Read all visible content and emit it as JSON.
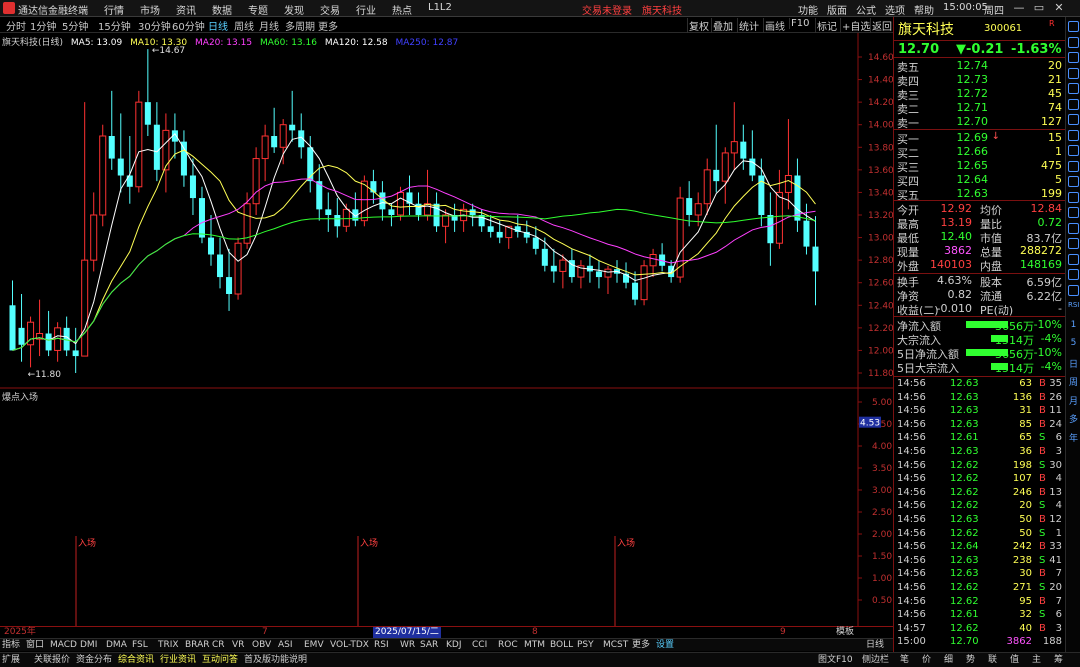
{
  "app": {
    "title": "通达信金融终端"
  },
  "menu": [
    "行情",
    "市场",
    "资讯",
    "数据",
    "专题",
    "发现",
    "交易",
    "行业",
    "热点",
    "L1L2"
  ],
  "red_menu": [
    "交易未登录",
    "旗天科技"
  ],
  "func_menu": [
    "功能",
    "版面",
    "公式",
    "选项",
    "帮助"
  ],
  "clock": {
    "time": "15:00:05",
    "weekday": "周四"
  },
  "window_buttons": [
    "—",
    "▭",
    "✕"
  ],
  "periods": [
    "分时",
    "1分钟",
    "5分钟",
    "15分钟",
    "30分钟",
    "60分钟",
    "日线",
    "周线",
    "月线",
    "多周期",
    "更多"
  ],
  "active_period": "日线",
  "tools": [
    "复权",
    "叠加",
    "统计",
    "画线",
    "F10",
    "标记",
    "+自选",
    "返回"
  ],
  "chart_header": {
    "label": "旗天科技(日线)",
    "ma": [
      {
        "text": "MA5: 13.09",
        "color": "#ffffff"
      },
      {
        "text": "MA10: 13.30",
        "color": "#ffff55"
      },
      {
        "text": "MA20: 13.15",
        "color": "#ff40ff"
      },
      {
        "text": "MA60: 13.16",
        "color": "#30ff30"
      },
      {
        "text": "MA120: 12.58",
        "color": "#ffffff"
      },
      {
        "text": "MA250: 12.87",
        "color": "#4040ff"
      }
    ]
  },
  "chart_data": {
    "type": "candlestick",
    "y_axis_ticks": [
      "14.60",
      "14.40",
      "14.20",
      "14.00",
      "13.80",
      "13.60",
      "13.40",
      "13.20",
      "13.00",
      "12.80",
      "12.60",
      "12.40",
      "12.20",
      "12.00",
      "11.80"
    ],
    "ylim": [
      11.8,
      14.6
    ],
    "high_label": "14.67",
    "low_label": "11.80",
    "candles": [
      [
        12.4,
        12.62,
        12.05,
        12.0
      ],
      [
        12.2,
        12.5,
        11.9,
        12.05
      ],
      [
        12.05,
        12.3,
        11.85,
        12.25
      ],
      [
        12.1,
        12.45,
        11.95,
        12.15
      ],
      [
        12.15,
        12.35,
        11.95,
        12.0
      ],
      [
        12.0,
        12.25,
        11.9,
        12.2
      ],
      [
        12.2,
        12.3,
        11.95,
        12.0
      ],
      [
        12.0,
        12.2,
        11.8,
        11.95
      ],
      [
        11.95,
        14.2,
        11.95,
        12.8
      ],
      [
        12.8,
        13.4,
        12.7,
        13.2
      ],
      [
        13.2,
        14.0,
        13.1,
        13.9
      ],
      [
        13.9,
        14.3,
        13.6,
        13.7
      ],
      [
        13.7,
        14.1,
        13.4,
        13.55
      ],
      [
        13.55,
        13.9,
        13.3,
        13.45
      ],
      [
        13.45,
        14.3,
        13.4,
        14.2
      ],
      [
        14.2,
        14.67,
        13.9,
        14.0
      ],
      [
        14.0,
        14.2,
        13.5,
        13.6
      ],
      [
        13.6,
        14.1,
        13.4,
        13.95
      ],
      [
        13.95,
        14.1,
        13.7,
        13.85
      ],
      [
        13.85,
        13.95,
        13.45,
        13.55
      ],
      [
        13.55,
        13.7,
        13.2,
        13.35
      ],
      [
        13.35,
        13.45,
        12.95,
        13.0
      ],
      [
        13.0,
        13.2,
        12.75,
        12.85
      ],
      [
        12.85,
        13.0,
        12.55,
        12.65
      ],
      [
        12.65,
        12.9,
        12.35,
        12.5
      ],
      [
        12.5,
        13.0,
        12.45,
        12.95
      ],
      [
        12.95,
        13.4,
        12.9,
        13.3
      ],
      [
        13.3,
        13.8,
        13.2,
        13.7
      ],
      [
        13.7,
        14.0,
        13.5,
        13.9
      ],
      [
        13.9,
        14.15,
        13.75,
        13.8
      ],
      [
        13.8,
        14.05,
        13.65,
        14.0
      ],
      [
        14.0,
        14.3,
        13.85,
        13.95
      ],
      [
        13.95,
        14.1,
        13.7,
        13.8
      ],
      [
        13.8,
        13.9,
        13.4,
        13.5
      ],
      [
        13.5,
        13.65,
        13.15,
        13.25
      ],
      [
        13.25,
        13.4,
        13.05,
        13.2
      ],
      [
        13.2,
        13.35,
        13.0,
        13.1
      ],
      [
        13.1,
        13.3,
        13.05,
        13.25
      ],
      [
        13.25,
        13.4,
        13.1,
        13.15
      ],
      [
        13.15,
        13.55,
        13.1,
        13.5
      ],
      [
        13.5,
        13.6,
        13.3,
        13.4
      ],
      [
        13.4,
        13.5,
        13.15,
        13.25
      ],
      [
        13.25,
        13.3,
        13.1,
        13.2
      ],
      [
        13.2,
        13.45,
        13.15,
        13.4
      ],
      [
        13.4,
        13.55,
        13.2,
        13.3
      ],
      [
        13.3,
        13.4,
        13.15,
        13.2
      ],
      [
        13.2,
        13.6,
        13.15,
        13.3
      ],
      [
        13.3,
        13.4,
        13.05,
        13.1
      ],
      [
        13.1,
        13.25,
        12.95,
        13.2
      ],
      [
        13.2,
        13.3,
        13.05,
        13.15
      ],
      [
        13.15,
        13.3,
        13.05,
        13.25
      ],
      [
        13.25,
        13.3,
        13.1,
        13.2
      ],
      [
        13.2,
        13.25,
        13.05,
        13.1
      ],
      [
        13.1,
        13.2,
        13.0,
        13.05
      ],
      [
        13.05,
        13.15,
        12.95,
        13.0
      ],
      [
        13.0,
        13.1,
        12.9,
        13.1
      ],
      [
        13.1,
        13.2,
        13.0,
        13.05
      ],
      [
        13.05,
        13.15,
        12.95,
        13.0
      ],
      [
        13.0,
        13.1,
        12.85,
        12.9
      ],
      [
        12.9,
        13.0,
        12.7,
        12.75
      ],
      [
        12.75,
        12.9,
        12.6,
        12.7
      ],
      [
        12.7,
        12.85,
        12.55,
        12.8
      ],
      [
        12.8,
        12.9,
        12.6,
        12.65
      ],
      [
        12.65,
        12.8,
        12.55,
        12.75
      ],
      [
        12.75,
        12.85,
        12.6,
        12.7
      ],
      [
        12.7,
        12.8,
        12.55,
        12.65
      ],
      [
        12.65,
        12.75,
        12.5,
        12.72
      ],
      [
        12.72,
        12.8,
        12.6,
        12.68
      ],
      [
        12.68,
        12.78,
        12.55,
        12.6
      ],
      [
        12.6,
        12.7,
        12.4,
        12.45
      ],
      [
        12.45,
        12.8,
        12.4,
        12.75
      ],
      [
        12.75,
        12.9,
        12.65,
        12.85
      ],
      [
        12.85,
        12.95,
        12.7,
        12.75
      ],
      [
        12.75,
        12.8,
        12.6,
        12.65
      ],
      [
        12.65,
        13.45,
        12.6,
        13.35
      ],
      [
        13.35,
        13.5,
        13.1,
        13.2
      ],
      [
        13.2,
        13.4,
        13.1,
        13.3
      ],
      [
        13.3,
        13.7,
        13.2,
        13.6
      ],
      [
        13.6,
        14.0,
        13.4,
        13.5
      ],
      [
        13.5,
        13.8,
        13.3,
        13.75
      ],
      [
        13.75,
        14.2,
        13.6,
        13.85
      ],
      [
        13.85,
        14.0,
        13.6,
        13.7
      ],
      [
        13.7,
        13.95,
        13.5,
        13.55
      ],
      [
        13.55,
        13.7,
        13.1,
        13.2
      ],
      [
        13.2,
        13.4,
        12.75,
        12.95
      ],
      [
        12.95,
        13.6,
        12.9,
        13.4
      ],
      [
        13.4,
        14.05,
        13.25,
        13.55
      ],
      [
        13.55,
        13.7,
        13.05,
        13.15
      ],
      [
        13.15,
        13.3,
        12.85,
        12.92
      ],
      [
        12.92,
        13.19,
        12.4,
        12.7
      ]
    ]
  },
  "sub_chart": {
    "title": "爆点入场",
    "y_axis_ticks": [
      "5.00",
      "4.50",
      "4.00",
      "3.50",
      "3.00",
      "2.50",
      "2.00",
      "1.50",
      "1.00",
      "0.50"
    ],
    "cursor_value": "4.53",
    "signals": [
      "入场",
      "入场",
      "入场"
    ]
  },
  "date_axis": {
    "labels": [
      "2025年",
      "7",
      "8",
      "9"
    ],
    "cursor": "2025/07/15/二"
  },
  "bottom_axis_right": {
    "templates": "模板",
    "period": "日线"
  },
  "indicator_tabs": [
    "指标",
    "窗口",
    "MACD",
    "DMI",
    "DMA",
    "FSL",
    "TRIX",
    "BRAR",
    "CR",
    "VR",
    "OBV",
    "ASI",
    "EMV",
    "VOL-TDX",
    "RSI",
    "WR",
    "SAR",
    "KDJ",
    "CCI",
    "ROC",
    "MTM",
    "BOLL",
    "PSY",
    "MCST",
    "更多",
    "设置"
  ],
  "bottom_tabs": [
    "扩展",
    "关联报价",
    "资金分布",
    "综合资讯",
    "行业资讯",
    "互动问答",
    "首及版功能说明"
  ],
  "bottom_right": [
    "图文F10",
    "侧边栏"
  ],
  "bottom_right_icons": [
    "笔",
    "价",
    "细",
    "势",
    "联",
    "值",
    "主",
    "筹"
  ],
  "quote": {
    "name": "旗天科技",
    "code": "300061",
    "flag": "R",
    "price": "12.70",
    "change": "▼-0.21",
    "change_pct": "-1.63%",
    "asks": [
      {
        "label": "卖五",
        "price": "12.74",
        "vol": "20"
      },
      {
        "label": "卖四",
        "price": "12.73",
        "vol": "21"
      },
      {
        "label": "卖三",
        "price": "12.72",
        "vol": "45"
      },
      {
        "label": "卖二",
        "price": "12.71",
        "vol": "74"
      },
      {
        "label": "卖一",
        "price": "12.70",
        "vol": "127"
      }
    ],
    "bids": [
      {
        "label": "买一",
        "price": "12.69",
        "vol": "15",
        "arrow": "↓"
      },
      {
        "label": "买二",
        "price": "12.66",
        "vol": "1",
        "arrow": ""
      },
      {
        "label": "买三",
        "price": "12.65",
        "vol": "475",
        "arrow": ""
      },
      {
        "label": "买四",
        "price": "12.64",
        "vol": "5",
        "arrow": ""
      },
      {
        "label": "买五",
        "price": "12.63",
        "vol": "199",
        "arrow": ""
      }
    ],
    "stats": [
      {
        "l1": "今开",
        "v1": "12.92",
        "c1": "#ff4040",
        "l2": "均价",
        "v2": "12.84",
        "c2": "#ff4040"
      },
      {
        "l1": "最高",
        "v1": "13.19",
        "c1": "#ff4040",
        "l2": "量比",
        "v2": "0.72",
        "c2": "#30ff30"
      },
      {
        "l1": "最低",
        "v1": "12.40",
        "c1": "#30ff30",
        "l2": "市值",
        "v2": "83.7亿",
        "c2": "#d0d0d0"
      },
      {
        "l1": "现量",
        "v1": "3862",
        "c1": "#ff55ff",
        "l2": "总量",
        "v2": "288272",
        "c2": "#ffff55"
      },
      {
        "l1": "外盘",
        "v1": "140103",
        "c1": "#ff4040",
        "l2": "内盘",
        "v2": "148169",
        "c2": "#30ff30"
      },
      {
        "l1": "换手",
        "v1": "4.63%",
        "c1": "#d0d0d0",
        "l2": "股本",
        "v2": "6.59亿",
        "c2": "#d0d0d0"
      },
      {
        "l1": "净资",
        "v1": "0.82",
        "c1": "#d0d0d0",
        "l2": "流通",
        "v2": "6.22亿",
        "c2": "#d0d0d0"
      },
      {
        "l1": "收益(二)",
        "v1": "-0.010",
        "c1": "#d0d0d0",
        "l2": "PE(动)",
        "v2": "-",
        "c2": "#d0d0d0"
      }
    ],
    "flows": [
      {
        "label": "净流入额",
        "value": "-3656万",
        "pct": "-10%",
        "bar": 1.0
      },
      {
        "label": "大宗流入",
        "value": "-1514万",
        "pct": "-4%",
        "bar": 0.4
      },
      {
        "label": "5日净流入额",
        "value": "-3656万",
        "pct": "-10%",
        "bar": 1.0
      },
      {
        "label": "5日大宗流入",
        "value": "-1514万",
        "pct": "-4%",
        "bar": 0.4
      }
    ],
    "ticks": [
      {
        "t": "14:56",
        "p": "12.63",
        "v": "63",
        "f": "B",
        "n": "35"
      },
      {
        "t": "14:56",
        "p": "12.63",
        "v": "136",
        "f": "B",
        "n": "26"
      },
      {
        "t": "14:56",
        "p": "12.63",
        "v": "31",
        "f": "B",
        "n": "11"
      },
      {
        "t": "14:56",
        "p": "12.63",
        "v": "85",
        "f": "B",
        "n": "24"
      },
      {
        "t": "14:56",
        "p": "12.61",
        "v": "65",
        "f": "S",
        "n": "6"
      },
      {
        "t": "14:56",
        "p": "12.63",
        "v": "36",
        "f": "B",
        "n": "3"
      },
      {
        "t": "14:56",
        "p": "12.62",
        "v": "198",
        "f": "S",
        "n": "30"
      },
      {
        "t": "14:56",
        "p": "12.62",
        "v": "107",
        "f": "B",
        "n": "4"
      },
      {
        "t": "14:56",
        "p": "12.62",
        "v": "246",
        "f": "B",
        "n": "13"
      },
      {
        "t": "14:56",
        "p": "12.62",
        "v": "20",
        "f": "S",
        "n": "4"
      },
      {
        "t": "14:56",
        "p": "12.63",
        "v": "50",
        "f": "B",
        "n": "12"
      },
      {
        "t": "14:56",
        "p": "12.62",
        "v": "50",
        "f": "S",
        "n": "1"
      },
      {
        "t": "14:56",
        "p": "12.64",
        "v": "242",
        "f": "B",
        "n": "33"
      },
      {
        "t": "14:56",
        "p": "12.63",
        "v": "238",
        "f": "S",
        "n": "41"
      },
      {
        "t": "14:56",
        "p": "12.63",
        "v": "30",
        "f": "B",
        "n": "7"
      },
      {
        "t": "14:56",
        "p": "12.62",
        "v": "271",
        "f": "S",
        "n": "20"
      },
      {
        "t": "14:56",
        "p": "12.62",
        "v": "95",
        "f": "B",
        "n": "7"
      },
      {
        "t": "14:56",
        "p": "12.61",
        "v": "32",
        "f": "S",
        "n": "6"
      },
      {
        "t": "14:57",
        "p": "12.62",
        "v": "40",
        "f": "B",
        "n": "3"
      },
      {
        "t": "15:00",
        "p": "12.70",
        "v": "3862",
        "f": "",
        "n": "188"
      }
    ]
  },
  "strip": [
    "RSI",
    "1",
    "5",
    "日",
    "周",
    "月",
    "多",
    "年"
  ],
  "colors": {
    "up": "#ff4040",
    "down": "#30ff30",
    "candle_up": "#ff3232",
    "candle_down": "#54ffff",
    "grid_red": "#8a1010"
  }
}
